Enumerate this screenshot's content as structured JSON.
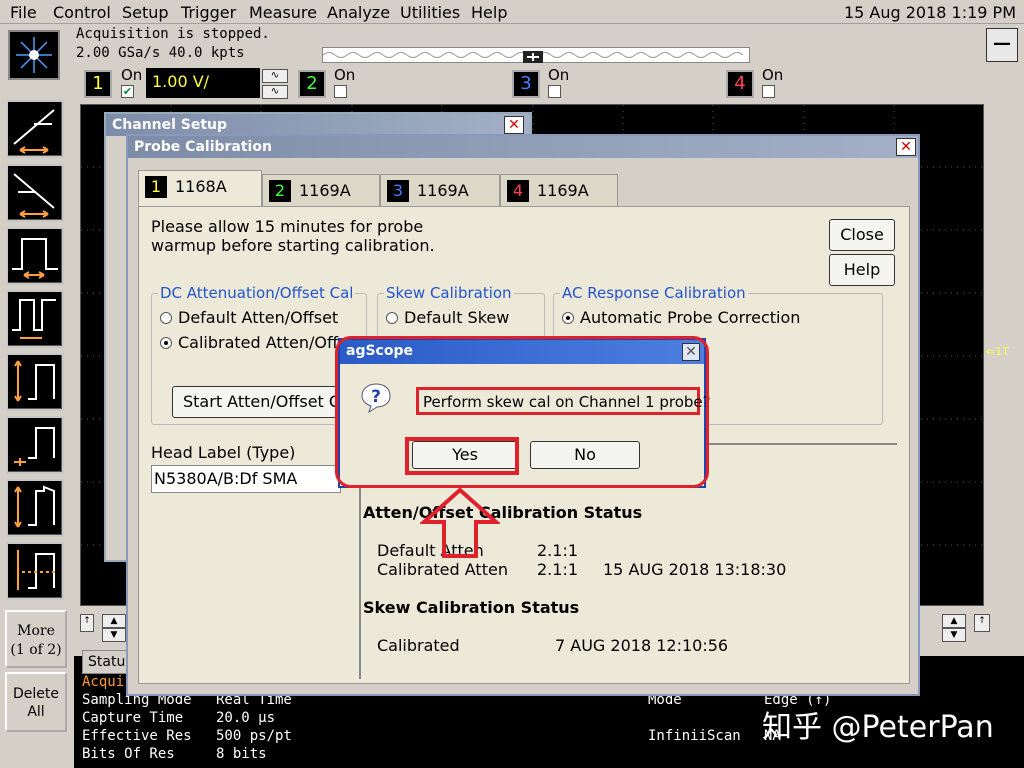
{
  "menu": {
    "items": [
      "File",
      "Control",
      "Setup",
      "Trigger",
      "Measure",
      "Analyze",
      "Utilities",
      "Help"
    ],
    "datetime": "15 Aug 2018  1:19 PM"
  },
  "acquisition": {
    "status": "Acquisition is stopped.",
    "rate": "2.00 GSa/s   40.0 kpts"
  },
  "channels": {
    "ch1": {
      "num": "1",
      "on_label": "On",
      "volts": "1.00 V/",
      "color": "#ffff40"
    },
    "ch2": {
      "num": "2",
      "on_label": "On",
      "color": "#40ff40"
    },
    "ch3": {
      "num": "3",
      "on_label": "On",
      "color": "#4080ff"
    },
    "ch4": {
      "num": "4",
      "on_label": "On",
      "color": "#ff4050"
    }
  },
  "left_toolbar": {
    "more_line1": "More",
    "more_line2": "(1 of 2)",
    "delete_line1": "Delete",
    "delete_line2": "All"
  },
  "channel_setup": {
    "title": "Channel Setup"
  },
  "probe_cal": {
    "title": "Probe Calibration",
    "tabs": [
      {
        "num": "1",
        "label": "1168A"
      },
      {
        "num": "2",
        "label": "1169A"
      },
      {
        "num": "3",
        "label": "1169A"
      },
      {
        "num": "4",
        "label": "1169A"
      }
    ],
    "info_line1": "Please allow 15 minutes for probe",
    "info_line2": "warmup before starting calibration.",
    "close_label": "Close",
    "help_label": "Help",
    "dc_group": {
      "title": "DC Attenuation/Offset Cal",
      "opt1": "Default Atten/Offset",
      "opt2": "Calibrated Atten/Offset",
      "start_btn": "Start Atten/Offset Cal..."
    },
    "skew_group": {
      "title": "Skew Calibration",
      "opt1": "Default Skew"
    },
    "ac_group": {
      "title": "AC Response Calibration",
      "opt1": "Automatic Probe Correction"
    },
    "head_label_title": "Head Label (Type)",
    "head_label_value": "N5380A/B:Df SMA",
    "status": {
      "atten_title": "Atten/Offset Calibration Status",
      "default_label": "Default Atten",
      "default_value": "2.1:1",
      "calibrated_label": "Calibrated Atten",
      "calibrated_value": "2.1:1",
      "calibrated_date": "15 AUG 2018 13:18:30",
      "skew_title": "Skew Calibration Status",
      "skew_label": "Calibrated",
      "skew_date": "7 AUG 2018 12:10:56"
    }
  },
  "dialog": {
    "title": "agScope",
    "message": "Perform skew cal on Channel 1 probe?",
    "yes_label": "Yes",
    "no_label": "No"
  },
  "status_area": {
    "tab_label": "Status",
    "row0_label": "Acqui",
    "row1_label": "Sampling Mode",
    "row1_value": "Real Time",
    "row2_label": "Capture Time",
    "row2_value": "20.0 µs",
    "row3_label": "Effective Res",
    "row3_value": "500 ps/pt",
    "row4_label": "Bits Of Res",
    "row4_value": "8 bits",
    "mode_label": "Mode",
    "mode_value": "Edge (↑)",
    "infiniiscan_label": "InfiniiScan",
    "infiniiscan_value": "NA"
  },
  "watermark": "知乎 @PeterPan",
  "colors": {
    "highlight": "#e0202a",
    "link_blue": "#2255cc"
  }
}
